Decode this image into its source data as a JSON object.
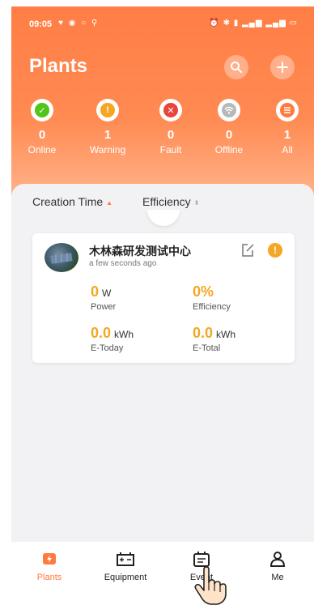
{
  "status_bar": {
    "time": "09:05"
  },
  "header": {
    "title": "Plants"
  },
  "stats": [
    {
      "count": "0",
      "label": "Online",
      "color": "#52c41a",
      "icon": "check-icon"
    },
    {
      "count": "1",
      "label": "Warning",
      "color": "#f5a623",
      "icon": "exclamation-icon"
    },
    {
      "count": "0",
      "label": "Fault",
      "color": "#e8453c",
      "icon": "x-icon"
    },
    {
      "count": "0",
      "label": "Offline",
      "color": "#b8b8b8",
      "icon": "wifi-icon"
    },
    {
      "count": "1",
      "label": "All",
      "color": "#ff7a3d",
      "icon": "list-icon"
    }
  ],
  "sort": {
    "creation_time": "Creation Time",
    "efficiency": "Efficiency"
  },
  "plant": {
    "name": "木林森研发测试中心",
    "time": "a few seconds ago",
    "power": {
      "value": "0",
      "unit": "W",
      "label": "Power"
    },
    "efficiency": {
      "value": "0%",
      "label": "Efficiency"
    },
    "e_today": {
      "value": "0.0",
      "unit": "kWh",
      "label": "E-Today"
    },
    "e_total": {
      "value": "0.0",
      "unit": "kWh",
      "label": "E-Total"
    }
  },
  "nav": {
    "plants": "Plants",
    "equipment": "Equipment",
    "event": "Event",
    "me": "Me"
  },
  "colors": {
    "accent": "#ff7a3d",
    "value": "#f5a623"
  }
}
